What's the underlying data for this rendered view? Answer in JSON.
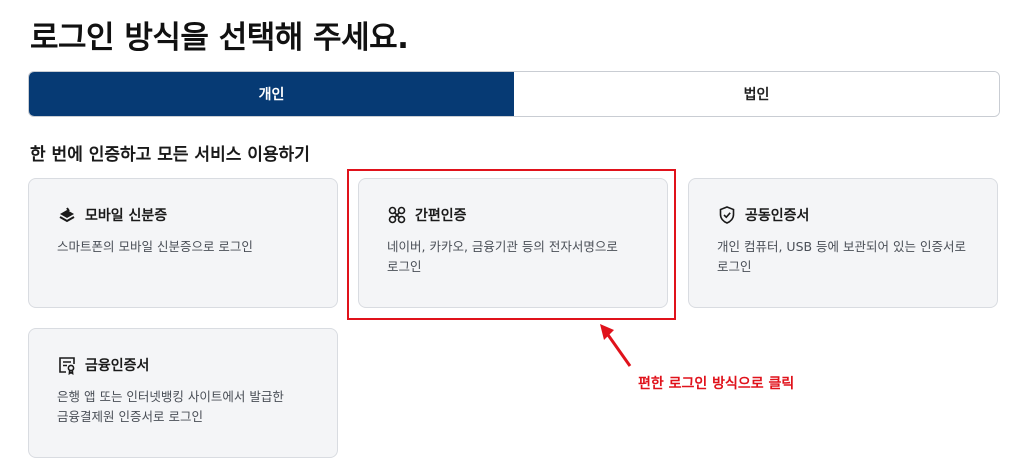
{
  "page": {
    "title": "로그인 방식을 선택해 주세요."
  },
  "tabs": [
    {
      "label": "개인",
      "active": true
    },
    {
      "label": "법인",
      "active": false
    }
  ],
  "section": {
    "title": "한 번에 인증하고 모든 서비스 이용하기"
  },
  "cards": [
    {
      "icon": "mobile-id-icon",
      "title": "모바일 신분증",
      "desc_line1": "스마트폰의 모바일 신분증으로 로그인",
      "desc_line2": ""
    },
    {
      "icon": "simple-auth-icon",
      "title": "간편인증",
      "desc_line1": "네이버, 카카오, 금융기관 등의 전자서명으로",
      "desc_line2": "로그인"
    },
    {
      "icon": "shield-check-icon",
      "title": "공동인증서",
      "desc_line1": "개인 컴퓨터, USB 등에 보관되어 있는 인증서로",
      "desc_line2": "로그인"
    },
    {
      "icon": "certificate-icon",
      "title": "금융인증서",
      "desc_line1": "은행 앱 또는 인터넷뱅킹 사이트에서 발급한",
      "desc_line2": "금융결제원 인증서로 로그인"
    }
  ],
  "annotation": {
    "text": "편한 로그인 방식으로 클릭",
    "color": "#e0121b"
  },
  "colors": {
    "accent": "#063a74",
    "card_bg": "#f4f5f7",
    "highlight": "#e0121b"
  }
}
